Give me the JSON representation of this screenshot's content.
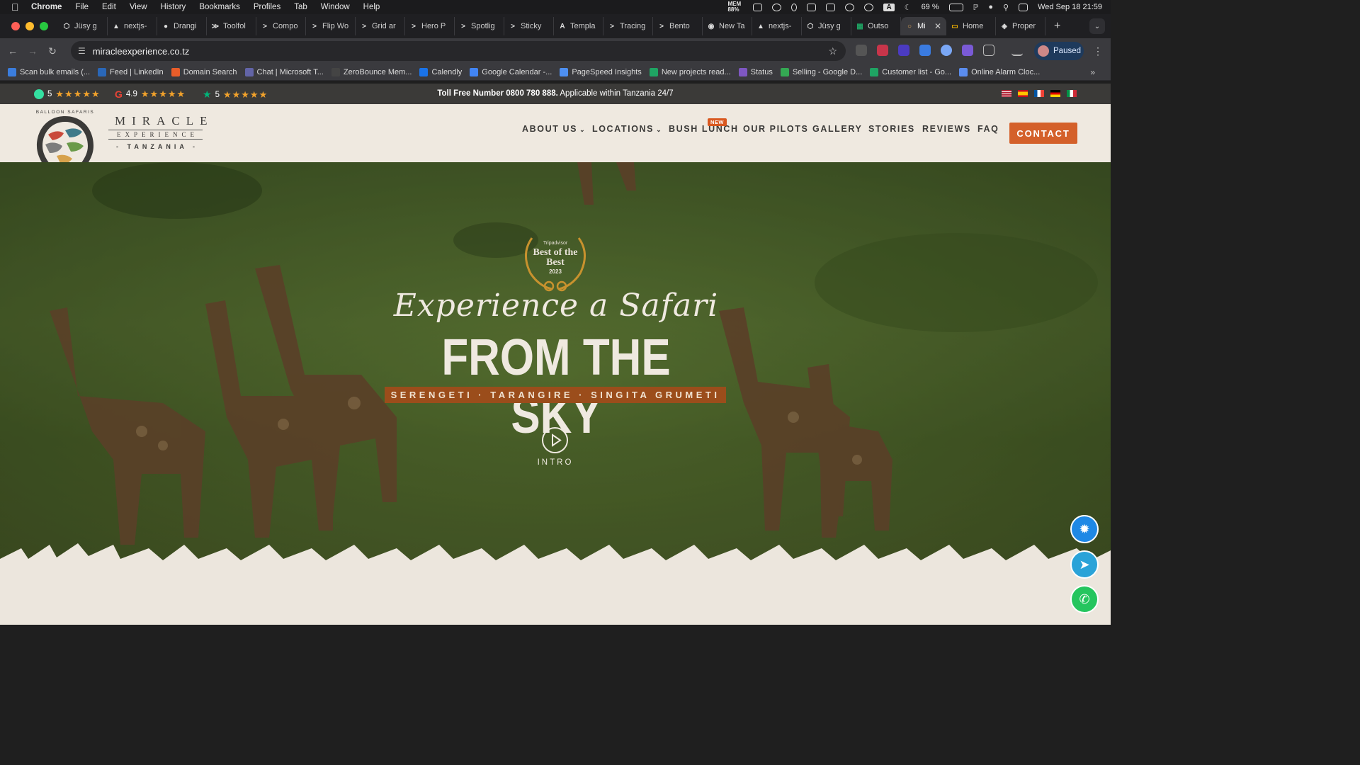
{
  "menubar": {
    "app": "Chrome",
    "items": [
      "File",
      "Edit",
      "View",
      "History",
      "Bookmarks",
      "Profiles",
      "Tab",
      "Window",
      "Help"
    ],
    "mem": "MEM 88%",
    "battery": "69 %",
    "datetime": "Wed Sep 18  21:59"
  },
  "tabs": [
    {
      "label": "Jüsy g",
      "icon": "dark-hexagon-icon"
    },
    {
      "label": "nextjs-",
      "icon": "vercel-triangle-icon"
    },
    {
      "label": "Drangi",
      "icon": "github-icon"
    },
    {
      "label": "Toolfol",
      "icon": "toolfolio-icon"
    },
    {
      "label": "Compo",
      "icon": "terminal-chevron-icon"
    },
    {
      "label": "Flip Wo",
      "icon": "terminal-chevron-icon"
    },
    {
      "label": "Grid ar",
      "icon": "terminal-chevron-icon"
    },
    {
      "label": "Hero P",
      "icon": "terminal-chevron-icon"
    },
    {
      "label": "Spotlig",
      "icon": "terminal-chevron-icon"
    },
    {
      "label": "Sticky",
      "icon": "terminal-chevron-icon"
    },
    {
      "label": "Templa",
      "icon": "aceternity-icon"
    },
    {
      "label": "Tracing",
      "icon": "terminal-chevron-icon"
    },
    {
      "label": "Bento",
      "icon": "terminal-chevron-icon"
    },
    {
      "label": "New Ta",
      "icon": "chrome-icon"
    },
    {
      "label": "nextjs-",
      "icon": "vercel-triangle-icon"
    },
    {
      "label": "Jüsy g",
      "icon": "dark-hexagon-icon"
    },
    {
      "label": "Outso",
      "icon": "sheets-icon"
    }
  ],
  "active_tab": {
    "label": "Mi",
    "icon": "balloon-icon"
  },
  "tabs_after": [
    {
      "label": "Home",
      "icon": "slides-icon"
    },
    {
      "label": "Proper",
      "icon": "proper-icon"
    }
  ],
  "address": {
    "url": "miracleexperience.co.tz"
  },
  "profile": {
    "status": "Paused"
  },
  "bookmarks": [
    {
      "label": "Scan bulk emails (...",
      "color": "#3b7ddd"
    },
    {
      "label": "Feed | LinkedIn",
      "color": "#2a67b8"
    },
    {
      "label": "Domain Search",
      "color": "#e85d2a"
    },
    {
      "label": "Chat | Microsoft T...",
      "color": "#6264a7"
    },
    {
      "label": "ZeroBounce Mem...",
      "color": "#444444"
    },
    {
      "label": "Calendly",
      "color": "#1a73e8"
    },
    {
      "label": "Google Calendar -...",
      "color": "#4285f4"
    },
    {
      "label": "PageSpeed Insights",
      "color": "#4e8ff0"
    },
    {
      "label": "New projects read...",
      "color": "#1fa463"
    },
    {
      "label": "Status",
      "color": "#7e57c2"
    },
    {
      "label": "Selling - Google D...",
      "color": "#34a853"
    },
    {
      "label": "Customer list - Go...",
      "color": "#1fa463"
    },
    {
      "label": "Online Alarm Cloc...",
      "color": "#5b8def"
    }
  ],
  "site": {
    "ratings": [
      {
        "source": "tripadvisor-icon",
        "score": "5",
        "stars": "★★★★★"
      },
      {
        "source": "google-icon",
        "score": "4.9",
        "stars": "★★★★★"
      },
      {
        "source": "trustpilot-icon",
        "score": "5",
        "stars": "★★★★★"
      }
    ],
    "tollfree_bold": "Toll Free Number 0800 780 888.",
    "tollfree_rest": " Applicable within Tanzania 24/7",
    "flags": [
      "us-flag",
      "es-flag",
      "fr-flag",
      "de-flag",
      "it-flag"
    ],
    "brand": {
      "arc_text": "BALLOON SAFARIS",
      "line1": "MIRACLE",
      "line2": "EXPERIENCE",
      "line3": "- TANZANIA -"
    },
    "nav": [
      {
        "label": "ABOUT US",
        "dropdown": true
      },
      {
        "label": "LOCATIONS",
        "dropdown": true
      },
      {
        "label": "BUSH LUNCH",
        "dropdown": false
      },
      {
        "label": "OUR PILOTS",
        "dropdown": false
      },
      {
        "label": "GALLERY",
        "dropdown": false
      },
      {
        "label": "STORIES",
        "dropdown": false
      },
      {
        "label": "REVIEWS",
        "dropdown": false
      },
      {
        "label": "FAQ",
        "dropdown": false
      }
    ],
    "new_badge": "NEW",
    "contact": "CONTACT",
    "hero": {
      "award_brand": "Tripadvisor",
      "award_title": "Best of the Best",
      "award_year": "2023",
      "script_line": "Experience a Safari",
      "title": "FROM THE SKY",
      "ribbon": "SERENGETI · TARANGIRE · SINGITA GRUMETI",
      "play_label": "INTRO"
    },
    "floating": [
      "messenger-icon",
      "telegram-icon",
      "whatsapp-icon"
    ],
    "colors": {
      "accent": "#d4602a",
      "ribbon": "#9b4d1b",
      "cream": "#efe9e0",
      "dark": "#3b3a38"
    }
  }
}
